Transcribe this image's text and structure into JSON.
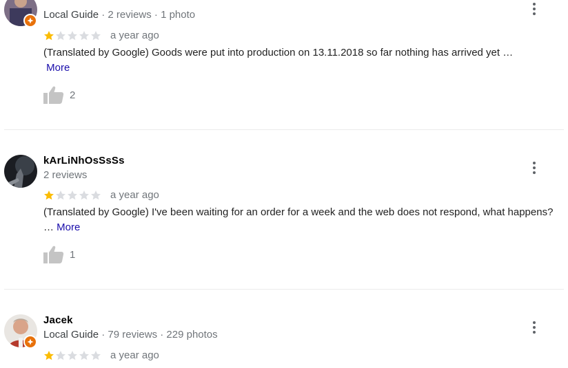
{
  "reviews": [
    {
      "name": "",
      "local_guide": "Local Guide",
      "stats": " · 2 reviews · 1 photo",
      "rating": 1,
      "time": "a year ago",
      "text": "(Translated by Google) Goods were put into production on 13.11.2018 so far nothing has arrived yet …",
      "more": "More",
      "likes": "2"
    },
    {
      "name": "kArLiNhOsSsSs",
      "local_guide": "",
      "stats": "2 reviews",
      "rating": 1,
      "time": "a year ago",
      "text": "(Translated by Google) I've been waiting for an order for a week and the web does not respond, what happens? …",
      "more": "More",
      "likes": "1"
    },
    {
      "name": "Jacek",
      "local_guide": "Local Guide",
      "stats": " · 79 reviews · 229 photos",
      "rating": 1,
      "time": "a year ago"
    }
  ],
  "colors": {
    "star_filled": "#fbbc04",
    "star_empty": "#dadce0",
    "badge": "#e8710a",
    "more_link": "#1a0dab"
  },
  "icons": {
    "like": "thumbs-up-icon",
    "menu": "more-vert-icon",
    "badge": "local-guide-badge-icon"
  }
}
